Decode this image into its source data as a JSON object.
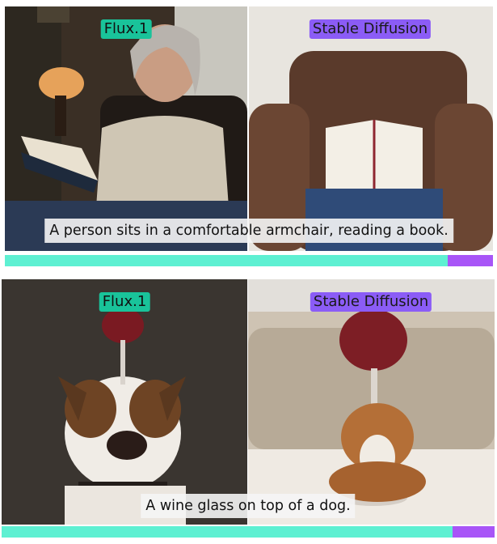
{
  "colors": {
    "flux": "#19c39a",
    "stable_diffusion": "#8b5cf6",
    "bar_flux": "#5ef0d2",
    "bar_sd": "#a855f7"
  },
  "rows": [
    {
      "left_label": "Flux.1",
      "right_label": "Stable Diffusion",
      "caption": "A person sits in a comfortable armchair, reading a book.",
      "flux_fraction": 0.908
    },
    {
      "left_label": "Flux.1",
      "right_label": "Stable Diffusion",
      "caption": "A wine glass on top of a dog.",
      "flux_fraction": 0.915
    }
  ]
}
